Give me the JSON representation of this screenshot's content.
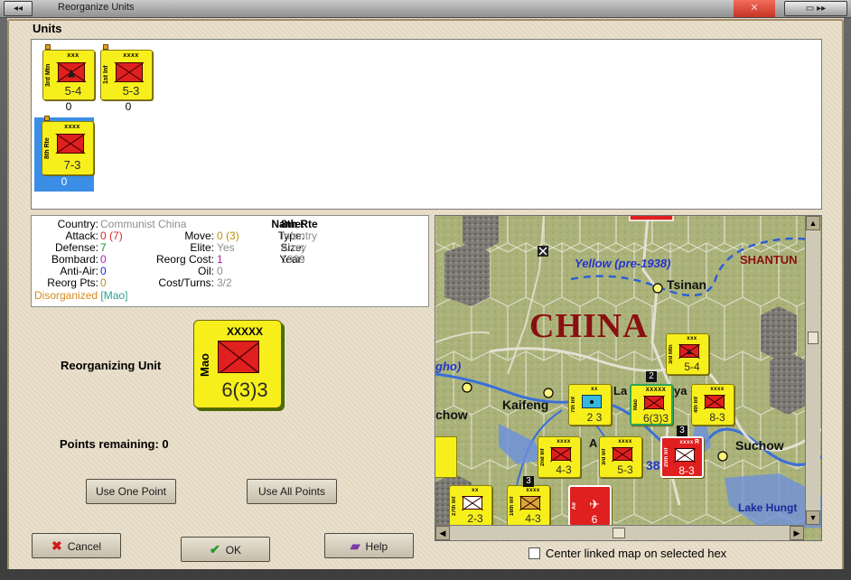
{
  "window": {
    "title": "Reorganize Units"
  },
  "colors": {
    "unit_yellow": "#f7ef1b",
    "unit_red_box": "#e01f1f",
    "selection_blue": "#3a8ee6"
  },
  "units_section": {
    "heading": "Units",
    "units": [
      {
        "side_label": "3rd Mtn",
        "size": "xxx",
        "stat": "5-4",
        "count": "0",
        "icon": "mountain-infantry-icon"
      },
      {
        "side_label": "1st Inf",
        "size": "xxxx",
        "stat": "5-3",
        "count": "0",
        "icon": "infantry-icon"
      },
      {
        "side_label": "8th Rte",
        "size": "xxxx",
        "stat": "7-3",
        "count": "0",
        "icon": "infantry-icon",
        "selected": true
      }
    ]
  },
  "info": {
    "country_label": "Country:",
    "country_value": "Communist China",
    "attack_label": "Attack:",
    "attack_value": "0",
    "attack_paren": "(7)",
    "defense_label": "Defense:",
    "defense_value": "7",
    "bombard_label": "Bombard:",
    "bombard_value": "0",
    "antiair_label": "Anti-Air:",
    "antiair_value": "0",
    "reorgpts_label": "Reorg Pts:",
    "reorgpts_value": "0",
    "move_label": "Move:",
    "move_value": "0",
    "move_paren": "(3)",
    "elite_label": "Elite:",
    "elite_value": "Yes",
    "reorgcost_label": "Reorg Cost:",
    "reorgcost_value": "1",
    "oil_label": "Oil:",
    "oil_value": "0",
    "costturns_label": "Cost/Turns:",
    "costturns_value": "3/2",
    "name_label": "Name:",
    "name_value": "8th Rte",
    "type_label": "Type:",
    "type_value": "Infantry",
    "size_label": "Size:",
    "size_value": "Army",
    "year_label": "Year:",
    "year_value": "1939",
    "status_value": "Disorganized",
    "status_hq": "[Mao]"
  },
  "reorganizing": {
    "label": "Reorganizing Unit",
    "counter": {
      "side_label": "Mao",
      "size": "XXXXX",
      "stat": "6(3)3"
    }
  },
  "points": {
    "label": "Points remaining:",
    "value": "0"
  },
  "buttons": {
    "use_one": "Use One Point",
    "use_all": "Use All Points",
    "cancel": "Cancel",
    "ok": "OK",
    "help": "Help"
  },
  "map": {
    "labels": {
      "shantung": "SHANTUN",
      "yellow_river": "Yellow (pre-1938)",
      "tsinan": "Tsinan",
      "china": "CHINA",
      "gho": "gho)",
      "kaifeng": "Kaifeng",
      "chow": "chow",
      "suchow": "Suchow",
      "lake": "Lake Hungt",
      "la": "La",
      "ya": "ya",
      "num38": "38",
      "a": "A"
    },
    "counters": [
      {
        "side_label": "3rd Mtn",
        "size": "xxx",
        "stat": "5-4",
        "color": "yellow"
      },
      {
        "side_label": "7th Inf",
        "size": "xx",
        "stat": "2 3",
        "color": "yellow",
        "box": "blue"
      },
      {
        "side_label": "Mao",
        "size": "XXXXX",
        "stat": "6(3)3",
        "color": "yellow"
      },
      {
        "side_label": "4th Inf",
        "size": "xxxx",
        "stat": "8-3",
        "color": "yellow"
      },
      {
        "side_label": "2nd Inf",
        "size": "xxxx",
        "stat": "4-3",
        "color": "yellow"
      },
      {
        "side_label": "3rd Inf",
        "size": "xxxx",
        "stat": "5-3",
        "color": "yellow"
      },
      {
        "side_label": "25th Inf",
        "size": "xxxx",
        "stat": "8-3",
        "color": "red",
        "corner": "R"
      },
      {
        "side_label": "27th Inf",
        "size": "xx",
        "stat": "2-3",
        "color": "yellow"
      },
      {
        "side_label": "16th Inf",
        "size": "xxxx",
        "stat": "4-3",
        "color": "yellow"
      },
      {
        "side_label": "Air",
        "size": "",
        "stat": "6",
        "color": "red"
      }
    ],
    "stack_numbers": [
      "2",
      "3",
      "3"
    ]
  },
  "center_linked": {
    "label": "Center linked map on selected hex",
    "checked": false
  }
}
